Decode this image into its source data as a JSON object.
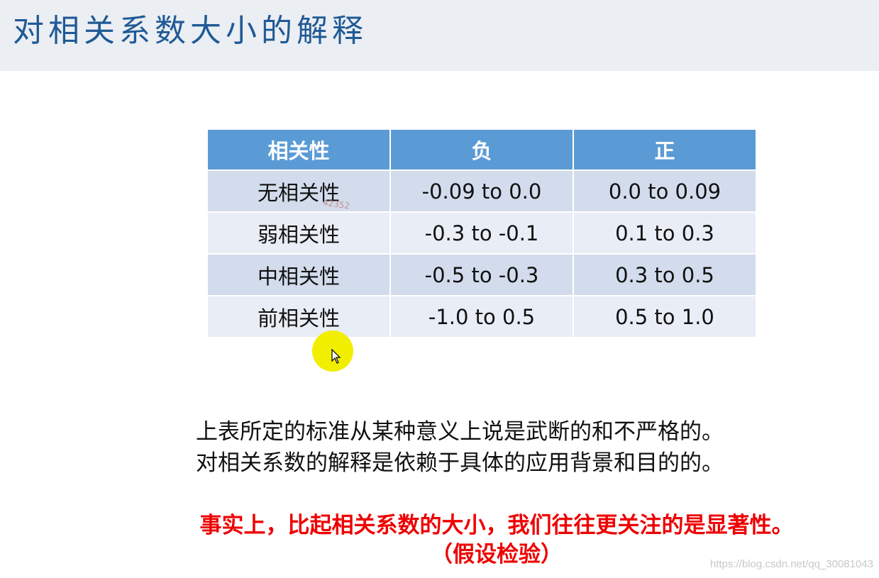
{
  "title": "对相关系数大小的解释",
  "table": {
    "headers": [
      "相关性",
      "负",
      "正"
    ],
    "rows": [
      {
        "label": "无相关性",
        "negative": "-0.09 to 0.0",
        "positive": "0.0 to 0.09"
      },
      {
        "label": "弱相关性",
        "negative": "-0.3 to -0.1",
        "positive": "0.1 to 0.3"
      },
      {
        "label": "中相关性",
        "negative": "-0.5 to -0.3",
        "positive": "0.3 to 0.5"
      },
      {
        "label": "前相关性",
        "negative": "-1.0 to 0.5",
        "positive": "0.5 to 1.0"
      }
    ]
  },
  "overlay_watermark": "42352",
  "notes": [
    "上表所定的标准从某种意义上说是武断的和不严格的。",
    "对相关系数的解释是依赖于具体的应用背景和目的的。"
  ],
  "emphasis": {
    "line1": "事实上，比起相关系数的大小，我们往往更关注的是显著性。",
    "line2": "（假设检验）",
    "color": "#ee0000"
  },
  "source_watermark": "https://blog.csdn.net/qq_30081043",
  "colors": {
    "header_bg": "#5b9bd5",
    "title_color": "#1f5a96",
    "title_bar_bg": "#ebeef2"
  }
}
